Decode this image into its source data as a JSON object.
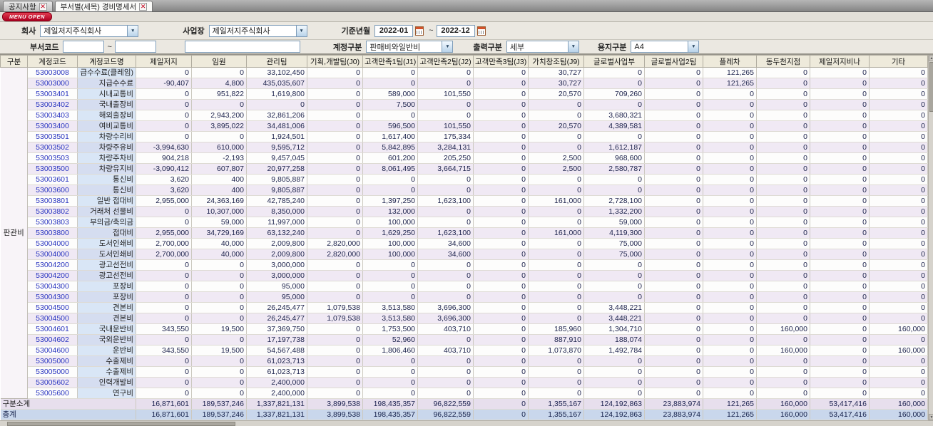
{
  "tabs": [
    {
      "label": "공지사항"
    },
    {
      "label": "부서별(세목) 경비명세서"
    }
  ],
  "menu_open_label": "MENU OPEN",
  "filters": {
    "company_label": "회사",
    "company_value": "제일저지주식회사",
    "site_label": "사업장",
    "site_value": "제일저지주식회사",
    "period_label": "기준년월",
    "period_from": "2022-01",
    "period_to": "2022-12",
    "period_separator": "~",
    "dept_code_label": "부서코드",
    "dept_code_from": "",
    "dept_code_to": "",
    "dept_name": "",
    "account_class_label": "계정구분",
    "account_class_value": "판매비와일반비",
    "output_class_label": "출력구분",
    "output_class_value": "세부",
    "paper_class_label": "용지구분",
    "paper_class_value": "A4"
  },
  "grid": {
    "columns": [
      "구분",
      "계정코드",
      "계정코드명",
      "제일저지",
      "임원",
      "관리팀",
      "기획,개발팀(J0)",
      "고객만족1팀(J1)",
      "고객만족2팀(J2)",
      "고객만족3팀(J3)",
      "가치창조팀(J9)",
      "글로벌사업부",
      "글로벌사업2팀",
      "플레차",
      "동두천지점",
      "제일저지비나",
      "기타"
    ],
    "group_label": "판관비",
    "rows": [
      {
        "code": "53003008",
        "name": "급수수료(클레임)",
        "values": [
          "0",
          "0",
          "33,102,450",
          "0",
          "0",
          "0",
          "0",
          "30,727",
          "0",
          "0",
          "121,265",
          "0",
          "0",
          "0"
        ]
      },
      {
        "code": "53003000",
        "name": "지급수수료",
        "values": [
          "-90,407",
          "4,800",
          "435,035,607",
          "0",
          "0",
          "0",
          "0",
          "30,727",
          "0",
          "0",
          "121,265",
          "0",
          "0",
          "0"
        ]
      },
      {
        "code": "53003401",
        "name": "시내교통비",
        "values": [
          "0",
          "951,822",
          "1,619,800",
          "0",
          "589,000",
          "101,550",
          "0",
          "20,570",
          "709,260",
          "0",
          "0",
          "0",
          "0",
          "0"
        ]
      },
      {
        "code": "53003402",
        "name": "국내출장비",
        "values": [
          "0",
          "0",
          "0",
          "0",
          "7,500",
          "0",
          "0",
          "0",
          "0",
          "0",
          "0",
          "0",
          "0",
          "0"
        ]
      },
      {
        "code": "53003403",
        "name": "해외출장비",
        "values": [
          "0",
          "2,943,200",
          "32,861,206",
          "0",
          "0",
          "0",
          "0",
          "0",
          "3,680,321",
          "0",
          "0",
          "0",
          "0",
          "0"
        ]
      },
      {
        "code": "53003400",
        "name": "여비교통비",
        "values": [
          "0",
          "3,895,022",
          "34,481,006",
          "0",
          "596,500",
          "101,550",
          "0",
          "20,570",
          "4,389,581",
          "0",
          "0",
          "0",
          "0",
          "0"
        ]
      },
      {
        "code": "53003501",
        "name": "차량수리비",
        "values": [
          "0",
          "0",
          "1,924,501",
          "0",
          "1,617,400",
          "175,334",
          "0",
          "0",
          "0",
          "0",
          "0",
          "0",
          "0",
          "0"
        ]
      },
      {
        "code": "53003502",
        "name": "차량주유비",
        "values": [
          "-3,994,630",
          "610,000",
          "9,595,712",
          "0",
          "5,842,895",
          "3,284,131",
          "0",
          "0",
          "1,612,187",
          "0",
          "0",
          "0",
          "0",
          "0"
        ]
      },
      {
        "code": "53003503",
        "name": "차량주차비",
        "values": [
          "904,218",
          "-2,193",
          "9,457,045",
          "0",
          "601,200",
          "205,250",
          "0",
          "2,500",
          "968,600",
          "0",
          "0",
          "0",
          "0",
          "0"
        ]
      },
      {
        "code": "53003500",
        "name": "차량유지비",
        "values": [
          "-3,090,412",
          "607,807",
          "20,977,258",
          "0",
          "8,061,495",
          "3,664,715",
          "0",
          "2,500",
          "2,580,787",
          "0",
          "0",
          "0",
          "0",
          "0"
        ]
      },
      {
        "code": "53003601",
        "name": "통신비",
        "values": [
          "3,620",
          "400",
          "9,805,887",
          "0",
          "0",
          "0",
          "0",
          "0",
          "0",
          "0",
          "0",
          "0",
          "0",
          "0"
        ]
      },
      {
        "code": "53003600",
        "name": "통신비",
        "values": [
          "3,620",
          "400",
          "9,805,887",
          "0",
          "0",
          "0",
          "0",
          "0",
          "0",
          "0",
          "0",
          "0",
          "0",
          "0"
        ]
      },
      {
        "code": "53003801",
        "name": "일반 접대비",
        "values": [
          "2,955,000",
          "24,363,169",
          "42,785,240",
          "0",
          "1,397,250",
          "1,623,100",
          "0",
          "161,000",
          "2,728,100",
          "0",
          "0",
          "0",
          "0",
          "0"
        ]
      },
      {
        "code": "53003802",
        "name": "거래처 선물비",
        "values": [
          "0",
          "10,307,000",
          "8,350,000",
          "0",
          "132,000",
          "0",
          "0",
          "0",
          "1,332,200",
          "0",
          "0",
          "0",
          "0",
          "0"
        ]
      },
      {
        "code": "53003803",
        "name": "부의금/축의금",
        "values": [
          "0",
          "59,000",
          "11,997,000",
          "0",
          "100,000",
          "0",
          "0",
          "0",
          "59,000",
          "0",
          "0",
          "0",
          "0",
          "0"
        ]
      },
      {
        "code": "53003800",
        "name": "접대비",
        "values": [
          "2,955,000",
          "34,729,169",
          "63,132,240",
          "0",
          "1,629,250",
          "1,623,100",
          "0",
          "161,000",
          "4,119,300",
          "0",
          "0",
          "0",
          "0",
          "0"
        ]
      },
      {
        "code": "53004000",
        "name": "도서인쇄비",
        "values": [
          "2,700,000",
          "40,000",
          "2,009,800",
          "2,820,000",
          "100,000",
          "34,600",
          "0",
          "0",
          "75,000",
          "0",
          "0",
          "0",
          "0",
          "0"
        ]
      },
      {
        "code": "53004000",
        "name": "도서인쇄비",
        "values": [
          "2,700,000",
          "40,000",
          "2,009,800",
          "2,820,000",
          "100,000",
          "34,600",
          "0",
          "0",
          "75,000",
          "0",
          "0",
          "0",
          "0",
          "0"
        ]
      },
      {
        "code": "53004200",
        "name": "광고선전비",
        "values": [
          "0",
          "0",
          "3,000,000",
          "0",
          "0",
          "0",
          "0",
          "0",
          "0",
          "0",
          "0",
          "0",
          "0",
          "0"
        ]
      },
      {
        "code": "53004200",
        "name": "광고선전비",
        "values": [
          "0",
          "0",
          "3,000,000",
          "0",
          "0",
          "0",
          "0",
          "0",
          "0",
          "0",
          "0",
          "0",
          "0",
          "0"
        ]
      },
      {
        "code": "53004300",
        "name": "포장비",
        "values": [
          "0",
          "0",
          "95,000",
          "0",
          "0",
          "0",
          "0",
          "0",
          "0",
          "0",
          "0",
          "0",
          "0",
          "0"
        ]
      },
      {
        "code": "53004300",
        "name": "포장비",
        "values": [
          "0",
          "0",
          "95,000",
          "0",
          "0",
          "0",
          "0",
          "0",
          "0",
          "0",
          "0",
          "0",
          "0",
          "0"
        ]
      },
      {
        "code": "53004500",
        "name": "견본비",
        "values": [
          "0",
          "0",
          "26,245,477",
          "1,079,538",
          "3,513,580",
          "3,696,300",
          "0",
          "0",
          "3,448,221",
          "0",
          "0",
          "0",
          "0",
          "0"
        ]
      },
      {
        "code": "53004500",
        "name": "견본비",
        "values": [
          "0",
          "0",
          "26,245,477",
          "1,079,538",
          "3,513,580",
          "3,696,300",
          "0",
          "0",
          "3,448,221",
          "0",
          "0",
          "0",
          "0",
          "0"
        ]
      },
      {
        "code": "53004601",
        "name": "국내운반비",
        "values": [
          "343,550",
          "19,500",
          "37,369,750",
          "0",
          "1,753,500",
          "403,710",
          "0",
          "185,960",
          "1,304,710",
          "0",
          "0",
          "160,000",
          "0",
          "160,000"
        ]
      },
      {
        "code": "53004602",
        "name": "국외운반비",
        "values": [
          "0",
          "0",
          "17,197,738",
          "0",
          "52,960",
          "0",
          "0",
          "887,910",
          "188,074",
          "0",
          "0",
          "0",
          "0",
          "0"
        ]
      },
      {
        "code": "53004600",
        "name": "운반비",
        "values": [
          "343,550",
          "19,500",
          "54,567,488",
          "0",
          "1,806,460",
          "403,710",
          "0",
          "1,073,870",
          "1,492,784",
          "0",
          "0",
          "160,000",
          "0",
          "160,000"
        ]
      },
      {
        "code": "53005000",
        "name": "수출제비",
        "values": [
          "0",
          "0",
          "61,023,713",
          "0",
          "0",
          "0",
          "0",
          "0",
          "0",
          "0",
          "0",
          "0",
          "0",
          "0"
        ]
      },
      {
        "code": "53005000",
        "name": "수출제비",
        "values": [
          "0",
          "0",
          "61,023,713",
          "0",
          "0",
          "0",
          "0",
          "0",
          "0",
          "0",
          "0",
          "0",
          "0",
          "0"
        ]
      },
      {
        "code": "53005602",
        "name": "인력개발비",
        "values": [
          "0",
          "0",
          "2,400,000",
          "0",
          "0",
          "0",
          "0",
          "0",
          "0",
          "0",
          "0",
          "0",
          "0",
          "0"
        ]
      },
      {
        "code": "53005600",
        "name": "연구비",
        "values": [
          "0",
          "0",
          "2,400,000",
          "0",
          "0",
          "0",
          "0",
          "0",
          "0",
          "0",
          "0",
          "0",
          "0",
          "0"
        ]
      }
    ],
    "subtotal": {
      "label": "구분소계",
      "values": [
        "16,871,601",
        "189,537,246",
        "1,337,821,131",
        "3,899,538",
        "198,435,357",
        "96,822,559",
        "0",
        "1,355,167",
        "124,192,863",
        "23,883,974",
        "121,265",
        "160,000",
        "53,417,416",
        "160,000"
      ]
    },
    "total": {
      "label": "총계",
      "values": [
        "16,871,601",
        "189,537,246",
        "1,337,821,131",
        "3,899,538",
        "198,435,357",
        "96,822,559",
        "0",
        "1,355,167",
        "124,192,863",
        "23,883,974",
        "121,265",
        "160,000",
        "53,417,416",
        "160,000"
      ]
    }
  },
  "colors": {
    "accent_red": "#c21c2c",
    "name_cell_bg": "#d9e6f6",
    "stripe_bg": "#f0e9f4",
    "total_row_bg": "#c9d7ec",
    "code_text": "#2a35c0"
  }
}
